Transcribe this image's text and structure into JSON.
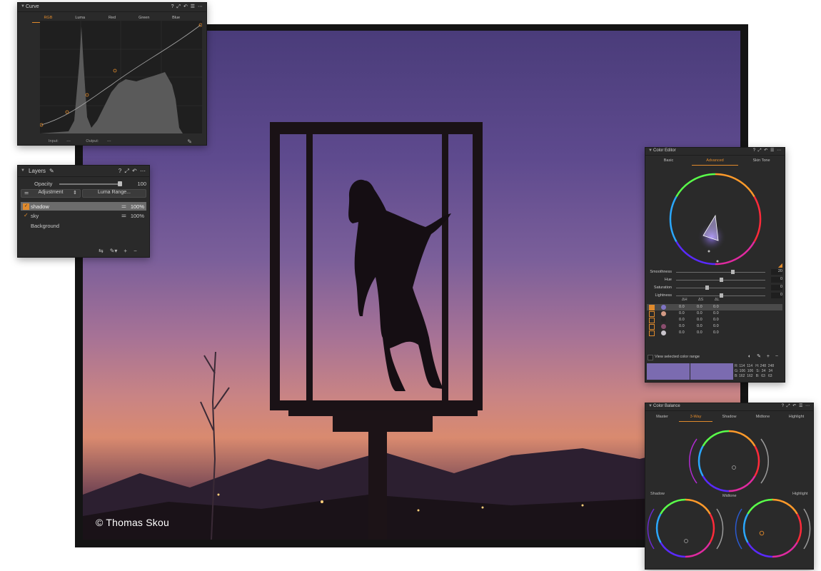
{
  "photo": {
    "credit": "© Thomas Skou"
  },
  "curve": {
    "title": "Curve",
    "tabs": [
      "RGB",
      "Luma",
      "Red",
      "Green",
      "Blue"
    ],
    "active_tab": "RGB",
    "input_label": "Input:",
    "input_value": "---",
    "output_label": "Output:",
    "output_value": "---"
  },
  "layers": {
    "title": "Layers",
    "opacity_label": "Opacity",
    "opacity_value": "100",
    "adjustment_label": "Adjustment",
    "luma_range_label": "Luma Range...",
    "items": [
      {
        "name": "shadow",
        "opacity": "100%",
        "selected": true
      },
      {
        "name": "sky",
        "opacity": "100%",
        "selected": false
      },
      {
        "name": "Background",
        "opacity": "",
        "selected": false
      }
    ]
  },
  "color_editor": {
    "title": "Color Editor",
    "tabs": [
      "Basic",
      "Advanced",
      "Skin Tone"
    ],
    "active_tab": "Advanced",
    "sliders": [
      {
        "label": "Smoothness",
        "value": "20",
        "level": 0.63
      },
      {
        "label": "Hue",
        "value": "0",
        "level": 0.5
      },
      {
        "label": "Saturation",
        "value": "0",
        "level": 0.34
      },
      {
        "label": "Lightness",
        "value": "0",
        "level": 0.5
      }
    ],
    "table_headers": [
      "ΔH",
      "ΔS",
      "ΔL"
    ],
    "rows": [
      {
        "color": "#7f74c4",
        "h": "0.0",
        "s": "0.0",
        "l": "0.0"
      },
      {
        "color": "#d39a85",
        "h": "0.0",
        "s": "0.0",
        "l": "0.0"
      },
      {
        "color": "#262626",
        "h": "0.0",
        "s": "0.0",
        "l": "0.0"
      },
      {
        "color": "#8a4d6e",
        "h": "0.0",
        "s": "0.0",
        "l": "0.0"
      },
      {
        "color": "#c9c5cc",
        "h": "0.0",
        "s": "0.0",
        "l": "0.0"
      }
    ],
    "view_selected_label": "View selected color range",
    "rgb_info": "R: 114  114   H: 248  248\nG: 106  106   S:  34   34\nB: 162  162   B:  63   63"
  },
  "color_balance": {
    "title": "Color Balance",
    "tabs": [
      "Master",
      "3-Way",
      "Shadow",
      "Midtone",
      "Highlight"
    ],
    "active_tab": "3-Way",
    "wheel_labels": {
      "shadow": "Shadow",
      "midtone": "Midtone",
      "highlight": "Highlight"
    }
  }
}
